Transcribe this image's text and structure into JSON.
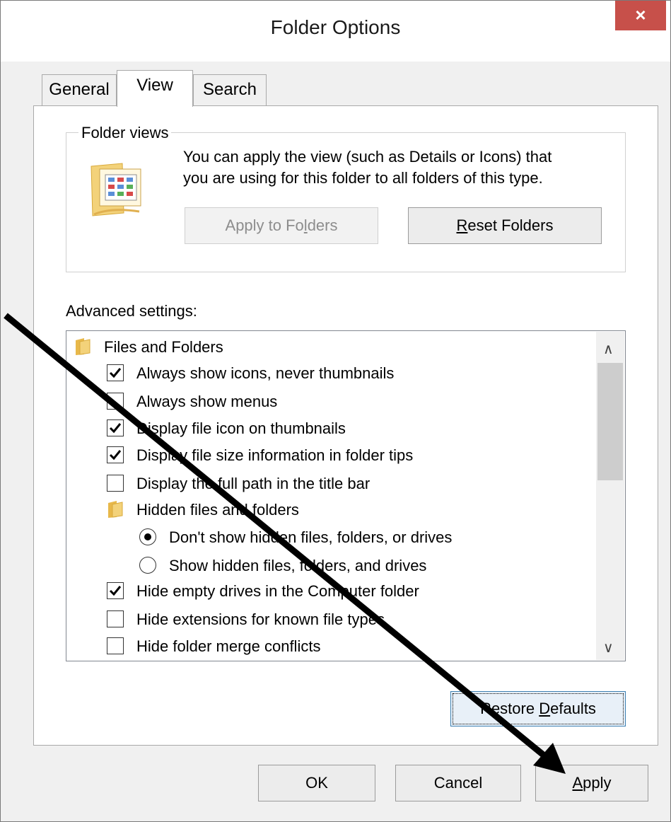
{
  "window": {
    "title": "Folder Options",
    "close_label": "×"
  },
  "tabs": [
    {
      "label": "General",
      "active": false
    },
    {
      "label": "View",
      "active": true
    },
    {
      "label": "Search",
      "active": false
    }
  ],
  "folder_views": {
    "group_label": "Folder views",
    "description_line1": "You can apply the view (such as Details or Icons) that",
    "description_line2": "you are using for this folder to all folders of this type.",
    "apply_to_folders": {
      "before": "Apply to Fo",
      "accel": "l",
      "after": "ders",
      "enabled": false
    },
    "reset_folders": {
      "before": "",
      "accel": "R",
      "after": "eset Folders",
      "enabled": true
    }
  },
  "advanced": {
    "label": "Advanced settings:",
    "items": [
      {
        "type": "folder",
        "label": "Files and Folders"
      },
      {
        "type": "checkbox",
        "label": "Always show icons, never thumbnails",
        "checked": true
      },
      {
        "type": "checkbox",
        "label": "Always show menus",
        "checked": false
      },
      {
        "type": "checkbox",
        "label": "Display file icon on thumbnails",
        "checked": true
      },
      {
        "type": "checkbox",
        "label": "Display file size information in folder tips",
        "checked": true
      },
      {
        "type": "checkbox",
        "label": "Display the full path in the title bar",
        "checked": false
      },
      {
        "type": "folder",
        "label": "Hidden files and folders"
      },
      {
        "type": "radio",
        "label": "Don't show hidden files, folders, or drives",
        "selected": true
      },
      {
        "type": "radio",
        "label": "Show hidden files, folders, and drives",
        "selected": false
      },
      {
        "type": "checkbox",
        "label": "Hide empty drives in the Computer folder",
        "checked": true
      },
      {
        "type": "checkbox",
        "label": "Hide extensions for known file types",
        "checked": false
      },
      {
        "type": "checkbox",
        "label": "Hide folder merge conflicts",
        "checked": false
      }
    ]
  },
  "restore_defaults": {
    "before": "Restore ",
    "accel": "D",
    "after": "efaults"
  },
  "footer": {
    "ok": {
      "before": "OK",
      "accel": "",
      "after": ""
    },
    "cancel": {
      "before": "Cancel",
      "accel": "",
      "after": ""
    },
    "apply": {
      "before": "",
      "accel": "A",
      "after": "pply"
    }
  },
  "colors": {
    "close_button": "#c7504a",
    "folder_icon": "#e8b84a",
    "annotation_arrow": "#000000"
  }
}
